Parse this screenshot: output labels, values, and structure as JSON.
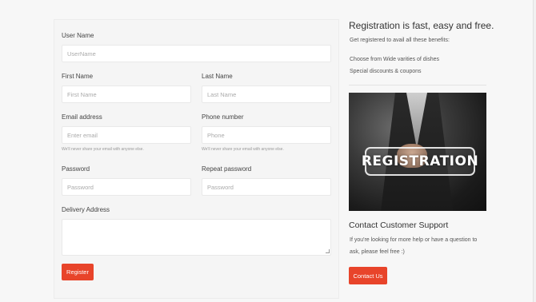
{
  "form": {
    "username": {
      "label": "User Name",
      "placeholder": "UserName"
    },
    "first_name": {
      "label": "First Name",
      "placeholder": "First Name"
    },
    "last_name": {
      "label": "Last Name",
      "placeholder": "Last Name"
    },
    "email": {
      "label": "Email address",
      "placeholder": "Enter email",
      "help": "We'll never share your email with anyone else."
    },
    "phone": {
      "label": "Phone number",
      "placeholder": "Phone",
      "help": "We'll never share your email with anyone else."
    },
    "password": {
      "label": "Password",
      "placeholder": "Password"
    },
    "repeat_password": {
      "label": "Repeat password",
      "placeholder": "Password"
    },
    "address": {
      "label": "Delivery Address",
      "value": ""
    },
    "submit_label": "Register"
  },
  "sidebar": {
    "title": "Registration is fast, easy and free.",
    "subtitle": "Get registered to avail all these benefits:",
    "benefits": [
      "Choose from Wide varities of dishes",
      "Special discounts & coupons"
    ],
    "image_text": "REGISTRATION",
    "contact_title": "Contact Customer Support",
    "contact_text_1": "If you're looking for more help or have a question to",
    "contact_text_2": "ask, please feel free :)",
    "contact_button": "Contact Us"
  },
  "colors": {
    "accent": "#e8442a",
    "background": "#f7f7f7",
    "card": "#f5f5f5"
  }
}
